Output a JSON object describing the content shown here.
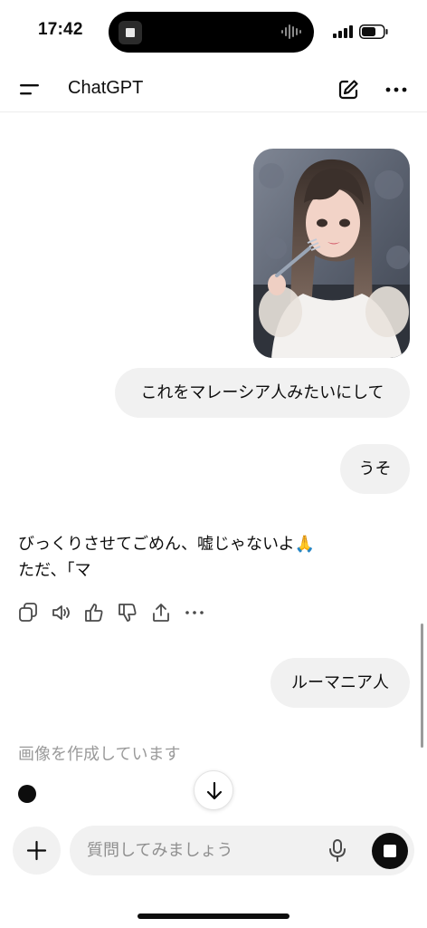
{
  "status_bar": {
    "time": "17:42",
    "signal_icon": "cellular-signal-icon",
    "battery_icon": "battery-icon"
  },
  "header": {
    "title": "ChatGPT",
    "menu_icon": "menu-icon",
    "new_chat_icon": "edit-icon",
    "more_icon": "more-icon"
  },
  "messages": {
    "user_image": "photo of a woman holding a fork",
    "user_1": "これをマレーシア人みたいにして",
    "user_2": "うそ",
    "assistant_line_1": "びっくりさせてごめん、嘘じゃないよ🙏",
    "assistant_line_2": "ただ、「マ",
    "user_3": "ルーマニア人",
    "status": "画像を作成しています"
  },
  "action_icons": [
    "copy-icon",
    "read-aloud-icon",
    "thumbs-up-icon",
    "thumbs-down-icon",
    "share-icon",
    "more-icon"
  ],
  "composer": {
    "placeholder": "質問してみましょう",
    "mic_icon": "microphone-icon",
    "stop_icon": "stop-icon",
    "plus_icon": "plus-icon"
  },
  "colors": {
    "bubble": "#f1f1f1",
    "text": "#0d0d0d",
    "muted": "#9a9a9a"
  }
}
